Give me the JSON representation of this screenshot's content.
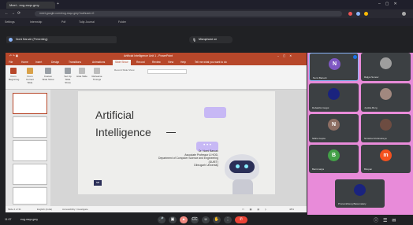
{
  "browser": {
    "tab_title": "Meet - eog-xsqz-gmy",
    "url": "meet.google.com/eog-xsqz-gmy?authuser=0",
    "bookmarks": [
      "Settings",
      "Internship",
      "Pdf",
      "Tulip Journal",
      "Folder"
    ]
  },
  "meet": {
    "presenter_label": "Nomi Baruah (Presenting)",
    "mic_banner": "Microphone on",
    "meeting_code": "eog-xsqz-gmy",
    "time": "11:07"
  },
  "powerpoint": {
    "doc_title": "Artificial Intelligence Unit 1 - PowerPoint",
    "ribbon_tabs": [
      "File",
      "Home",
      "Insert",
      "Design",
      "Transitions",
      "Animations",
      "Slide Show",
      "Record",
      "Review",
      "View",
      "Help",
      "Tell me what you want to do"
    ],
    "active_tab": "Slide Show",
    "ribbon_buttons": [
      "From Beginning",
      "From Current Slide",
      "Custom Slide Show",
      "Set Up Slide Show",
      "Hide Slide",
      "Rehearse Timings",
      "Record Slide Show"
    ],
    "status_slide": "Slide 2 of 31",
    "status_lang": "English (India)",
    "status_access": "Accessibility: Investigate",
    "zoom": "48%"
  },
  "slide": {
    "title_line1": "Artificial",
    "title_line2": "Intelligence",
    "author": "Dr. Nomi Baruah",
    "role": "Associate Professor & HOD,",
    "dept_line1": "Department of Computer Science and Engineering",
    "dept_line2": "(DUIET)",
    "university": "Dibrugarh University",
    "logo_badge": "NB"
  },
  "participants": [
    {
      "name": "Nomi Baruah",
      "initial": "N",
      "color": "#7e57c2"
    },
    {
      "name": "Rajiya Sonow",
      "initial": "",
      "color": "#5f6368"
    },
    {
      "name": "Debashis Gogoi",
      "initial": "",
      "color": "#5f6368"
    },
    {
      "name": "Jyotika Borg",
      "initial": "",
      "color": "#5f6368"
    },
    {
      "name": "Nibha Gupta",
      "initial": "N",
      "color": "#8d6e63"
    },
    {
      "name": "Nimisha Krishnatreya",
      "initial": "",
      "color": "#5f6368"
    },
    {
      "name": "Barnimalya",
      "initial": "B",
      "color": "#43a047"
    },
    {
      "name": "Bitopan",
      "initial": "m",
      "color": "#f4511e"
    },
    {
      "name": "Pronamitheng Basumatary",
      "initial": "",
      "color": "#5f6368"
    }
  ]
}
